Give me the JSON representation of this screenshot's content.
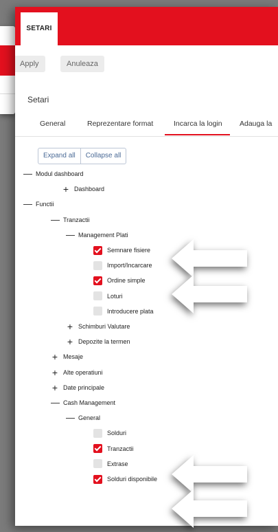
{
  "topbar": {
    "tab_label": "SETARI"
  },
  "toolbar": {
    "apply_label": "Apply",
    "cancel_label": "Anuleaza"
  },
  "page": {
    "title": "Setari"
  },
  "tabs": [
    {
      "label": "General"
    },
    {
      "label": "Reprezentare format"
    },
    {
      "label": "Incarca la login",
      "active": true
    },
    {
      "label": "Adauga la"
    }
  ],
  "tree_controls": {
    "expand_all": "Expand all",
    "collapse_all": "Collapse all"
  },
  "tree": [
    {
      "label": "Modul dashboard",
      "kind": "toggle",
      "icon": "minus-icon",
      "level": 0
    },
    {
      "label": "Dashboard",
      "kind": "toggle",
      "icon": "plus-icon",
      "level": 1
    },
    {
      "label": "Functii",
      "kind": "toggle",
      "icon": "minus-icon",
      "level": 0
    },
    {
      "label": "Tranzactii",
      "kind": "toggle",
      "icon": "minus-icon",
      "level": 1
    },
    {
      "label": "Management Plati",
      "kind": "toggle",
      "icon": "minus-icon",
      "level": 2
    },
    {
      "label": "Semnare fisiere",
      "kind": "check",
      "checked": true,
      "level": 3
    },
    {
      "label": "Import/Incarcare",
      "kind": "check",
      "checked": false,
      "level": 3
    },
    {
      "label": "Ordine simple",
      "kind": "check",
      "checked": true,
      "level": 3
    },
    {
      "label": "Loturi",
      "kind": "check",
      "checked": false,
      "level": 3
    },
    {
      "label": "Introducere plata",
      "kind": "check",
      "checked": false,
      "level": 3
    },
    {
      "label": "Schimburi Valutare",
      "kind": "toggle",
      "icon": "plus-icon",
      "level": 2
    },
    {
      "label": "Depozite la termen",
      "kind": "toggle",
      "icon": "plus-icon",
      "level": 2
    },
    {
      "label": "Mesaje",
      "kind": "toggle",
      "icon": "plus-icon",
      "level": 1
    },
    {
      "label": "Alte operatiuni",
      "kind": "toggle",
      "icon": "plus-icon",
      "level": 1
    },
    {
      "label": "Date principale",
      "kind": "toggle",
      "icon": "plus-icon",
      "level": 1
    },
    {
      "label": "Cash Management",
      "kind": "toggle",
      "icon": "minus-icon",
      "level": 1
    },
    {
      "label": "General",
      "kind": "toggle",
      "icon": "minus-icon",
      "level": 2
    },
    {
      "label": "Solduri",
      "kind": "check",
      "checked": false,
      "level": 3
    },
    {
      "label": "Tranzactii",
      "kind": "check",
      "checked": true,
      "level": 3
    },
    {
      "label": "Extrase",
      "kind": "check",
      "checked": false,
      "level": 3
    },
    {
      "label": "Solduri disponibile",
      "kind": "check",
      "checked": true,
      "level": 3
    }
  ],
  "colors": {
    "accent": "#e3101e",
    "checkbox_off": "#e3e3e3",
    "link": "#4a6a96"
  }
}
